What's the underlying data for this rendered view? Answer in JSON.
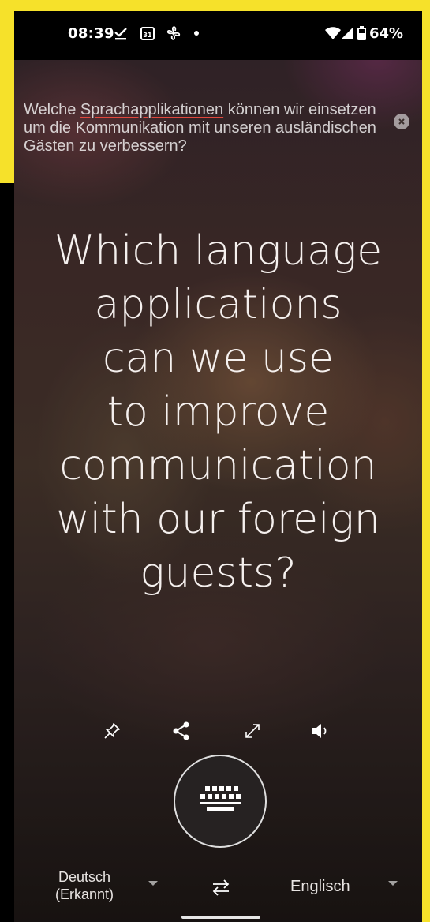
{
  "status_bar": {
    "time": "08:39",
    "battery_pct": "64%",
    "icons": [
      "download-done-icon",
      "calendar-icon",
      "fan-icon",
      "notification-dot-icon",
      "wifi-icon",
      "cellular-icon",
      "battery-icon"
    ],
    "calendar_day": "31"
  },
  "source": {
    "text_before": "Welche ",
    "highlight": "Sprachapplikationen",
    "text_after": " können wir einsetzen um die Kommunikation mit unseren ausländischen Gästen zu verbessern?"
  },
  "translation": {
    "lines": [
      "Which language",
      "applications",
      "can we use",
      "to improve",
      "communication",
      "with our foreign",
      "guests?"
    ]
  },
  "actions": [
    "pin-icon",
    "share-icon",
    "fullscreen-icon",
    "speaker-icon"
  ],
  "keyboard": {
    "icon": "keyboard-icon"
  },
  "languages": {
    "source_line1": "Deutsch",
    "source_line2": "(Erkannt)",
    "target": "Englisch",
    "swap_icon": "swap-icon"
  },
  "colors": {
    "highlight_underline": "#e0463c",
    "frame": "#f6e12a"
  }
}
